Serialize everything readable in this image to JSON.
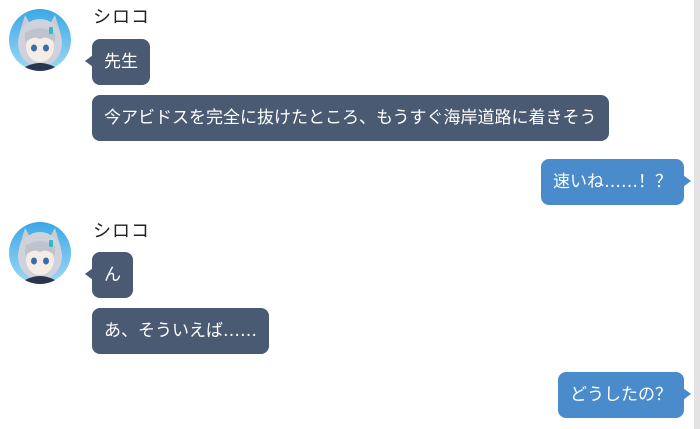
{
  "colors": {
    "incoming_bubble": "#4a5a72",
    "outgoing_bubble": "#4a8bcc",
    "bubble_text": "#ffffff",
    "name_text": "#222222",
    "background": "#ffffff"
  },
  "chat": {
    "groups": [
      {
        "sender": "シロコ",
        "avatar_icon": "shiroko-avatar-icon",
        "messages": [
          "先生",
          "今アビドスを完全に抜けたところ、もうすぐ海岸道路に着きそう"
        ]
      },
      {
        "sender": "outgoing",
        "messages": [
          "速いね……！？"
        ]
      },
      {
        "sender": "シロコ",
        "avatar_icon": "shiroko-avatar-icon",
        "messages": [
          "ん",
          "あ、そういえば……"
        ]
      },
      {
        "sender": "outgoing",
        "messages": [
          "どうしたの？"
        ]
      }
    ]
  }
}
